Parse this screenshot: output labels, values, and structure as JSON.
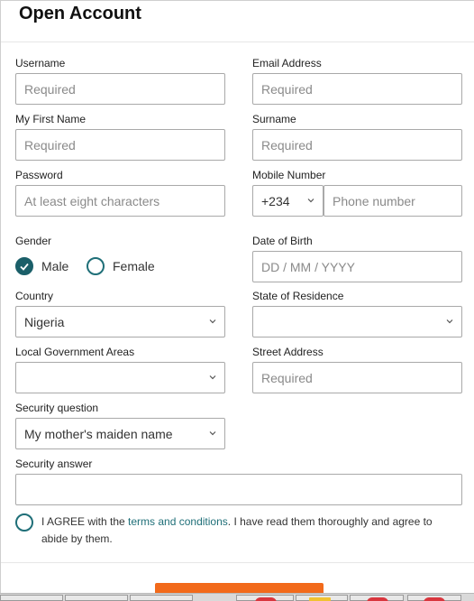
{
  "title": "Open Account",
  "fields": {
    "username": {
      "label": "Username",
      "placeholder": "Required"
    },
    "email": {
      "label": "Email Address",
      "placeholder": "Required"
    },
    "first_name": {
      "label": "My First Name",
      "placeholder": "Required"
    },
    "surname": {
      "label": "Surname",
      "placeholder": "Required"
    },
    "password": {
      "label": "Password",
      "placeholder": "At least eight characters"
    },
    "mobile": {
      "label": "Mobile Number",
      "country_code": "+234",
      "placeholder": "Phone number"
    },
    "gender": {
      "label": "Gender",
      "options": [
        "Male",
        "Female"
      ],
      "selected": "Male"
    },
    "dob": {
      "label": "Date of Birth",
      "placeholder": "DD / MM / YYYY"
    },
    "country": {
      "label": "Country",
      "value": "Nigeria"
    },
    "state": {
      "label": "State of Residence",
      "value": ""
    },
    "lga": {
      "label": "Local Government Areas",
      "value": ""
    },
    "street": {
      "label": "Street Address",
      "placeholder": "Required"
    },
    "security_question": {
      "label": "Security question",
      "value": "My mother's maiden name"
    },
    "security_answer": {
      "label": "Security answer",
      "placeholder": ""
    }
  },
  "agreement": {
    "prefix": "I AGREE with the ",
    "link": "terms and conditions",
    "suffix": ". I have read them thoroughly and agree to abide by them."
  },
  "colors": {
    "accent": "#1b5f69",
    "cta": "#f26a1b"
  }
}
